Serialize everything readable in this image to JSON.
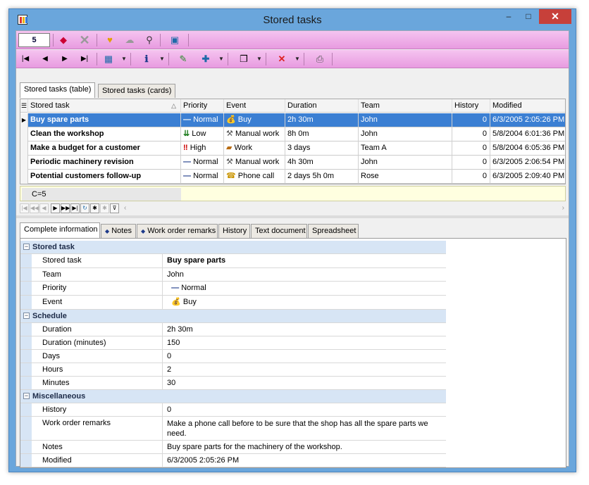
{
  "window": {
    "title": "Stored tasks",
    "icon": "app-chart-icon",
    "controls": {
      "minimize": "–",
      "maximize": "□",
      "close": "✕"
    }
  },
  "toolbar1": {
    "counter": "5",
    "icons": [
      "edit-record-icon",
      "delete-record-icon",
      "group-icon",
      "cloud-icon",
      "zoom-icon",
      "layout-icon"
    ]
  },
  "toolbar2": {
    "icons": [
      "first-record-icon",
      "prev-record-icon",
      "next-record-icon",
      "last-record-icon",
      "edit-grid-icon",
      "info-icon",
      "note-icon",
      "add-icon",
      "copy-icon",
      "clear-filter-icon",
      "print-icon"
    ]
  },
  "top_tabs": [
    {
      "label": "Stored tasks (table)",
      "active": true
    },
    {
      "label": "Stored tasks (cards)",
      "active": false
    }
  ],
  "grid": {
    "columns": [
      "Stored task",
      "Priority",
      "Event",
      "Duration",
      "Team",
      "History",
      "Modified"
    ],
    "rows": [
      {
        "task": "Buy spare parts",
        "priority": "Normal",
        "priority_icon": "dash-icon",
        "event": "Buy",
        "event_icon": "money-bag-icon",
        "duration": "2h 30m",
        "team": "John",
        "history": "0",
        "modified": "6/3/2005 2:05:26 PM",
        "selected": true
      },
      {
        "task": "Clean the workshop",
        "priority": "Low",
        "priority_icon": "down-arrows-icon",
        "event": "Manual work",
        "event_icon": "hammer-icon",
        "duration": "8h 0m",
        "team": "John",
        "history": "0",
        "modified": "5/8/2004 6:01:36 PM",
        "selected": false
      },
      {
        "task": "Make a budget for a customer",
        "priority": "High",
        "priority_icon": "exclamation-icon",
        "event": "Work",
        "event_icon": "briefcase-icon",
        "duration": "3 days",
        "team": "Team A",
        "history": "0",
        "modified": "5/8/2004 6:05:36 PM",
        "selected": false
      },
      {
        "task": "Periodic machinery revision",
        "priority": "Normal",
        "priority_icon": "dash-icon",
        "event": "Manual work",
        "event_icon": "hammer-icon",
        "duration": "4h 30m",
        "team": "John",
        "history": "0",
        "modified": "6/3/2005 2:06:54 PM",
        "selected": false
      },
      {
        "task": "Potential customers follow-up",
        "priority": "Normal",
        "priority_icon": "dash-icon",
        "event": "Phone call",
        "event_icon": "phone-icon",
        "duration": "2 days 5h 0m",
        "team": "Rose",
        "history": "0",
        "modified": "6/3/2005 2:09:40 PM",
        "selected": false
      }
    ],
    "footer_summary": "C=5"
  },
  "bottom_tabs": [
    "Complete information",
    "Notes",
    "Work order remarks",
    "History",
    "Text document",
    "Spreadsheet"
  ],
  "inspector": {
    "cat_stored_task": "Stored task",
    "stored_task": {
      "label": "Stored task",
      "value": "Buy spare parts"
    },
    "team": {
      "label": "Team",
      "value": "John"
    },
    "priority": {
      "label": "Priority",
      "value": "Normal"
    },
    "event": {
      "label": "Event",
      "value": "Buy"
    },
    "cat_schedule": "Schedule",
    "duration": {
      "label": "Duration",
      "value": "2h 30m"
    },
    "duration_minutes": {
      "label": "Duration (minutes)",
      "value": "150"
    },
    "days": {
      "label": "Days",
      "value": "0"
    },
    "hours": {
      "label": "Hours",
      "value": "2"
    },
    "minutes": {
      "label": "Minutes",
      "value": "30"
    },
    "cat_misc": "Miscellaneous",
    "history": {
      "label": "History",
      "value": "0"
    },
    "work_order_remarks": {
      "label": "Work order remarks",
      "value": "Make a phone call before to be sure that the shop has all the spare parts we need."
    },
    "notes": {
      "label": "Notes",
      "value": "Buy spare parts for the machinery of the workshop."
    },
    "modified": {
      "label": "Modified",
      "value": "6/3/2005 2:05:26 PM"
    }
  },
  "colors": {
    "toolbar": "#e89be0",
    "selection": "#3b7fd3",
    "category": "#d7e5f5",
    "title_bar": "#6aa6dc",
    "close": "#c7403a"
  }
}
